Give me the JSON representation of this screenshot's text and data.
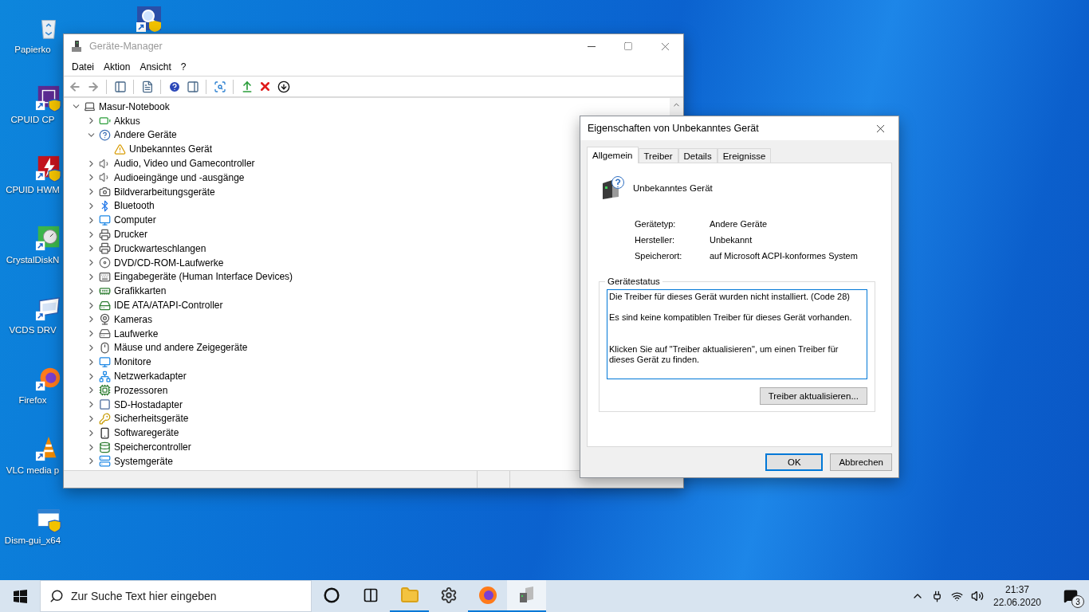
{
  "desktop_icons": [
    {
      "label": "Papierko"
    },
    {
      "label": "CPUID CP"
    },
    {
      "label": "CPUID HWM"
    },
    {
      "label": "CrystalDiskN"
    },
    {
      "label": "VCDS DRV"
    },
    {
      "label": "Firefox"
    },
    {
      "label": "VLC media p"
    },
    {
      "label": "Dism-gui_x64"
    }
  ],
  "device_manager": {
    "title": "Geräte-Manager",
    "menu": [
      "Datei",
      "Aktion",
      "Ansicht",
      "?"
    ],
    "tree": {
      "label": "Masur-Notebook",
      "expanded": true,
      "children": [
        {
          "label": "Akkus",
          "expanded": false
        },
        {
          "label": "Andere Geräte",
          "expanded": true,
          "children": [
            {
              "label": "Unbekanntes Gerät"
            }
          ]
        },
        {
          "label": "Audio, Video und Gamecontroller",
          "expanded": false
        },
        {
          "label": "Audioeingänge und -ausgänge",
          "expanded": false
        },
        {
          "label": "Bildverarbeitungsgeräte",
          "expanded": false
        },
        {
          "label": "Bluetooth",
          "expanded": false
        },
        {
          "label": "Computer",
          "expanded": false
        },
        {
          "label": "Drucker",
          "expanded": false
        },
        {
          "label": "Druckwarteschlangen",
          "expanded": false
        },
        {
          "label": "DVD/CD-ROM-Laufwerke",
          "expanded": false
        },
        {
          "label": "Eingabegeräte (Human Interface Devices)",
          "expanded": false
        },
        {
          "label": "Grafikkarten",
          "expanded": false
        },
        {
          "label": "IDE ATA/ATAPI-Controller",
          "expanded": false
        },
        {
          "label": "Kameras",
          "expanded": false
        },
        {
          "label": "Laufwerke",
          "expanded": false
        },
        {
          "label": "Mäuse und andere Zeigegeräte",
          "expanded": false
        },
        {
          "label": "Monitore",
          "expanded": false
        },
        {
          "label": "Netzwerkadapter",
          "expanded": false
        },
        {
          "label": "Prozessoren",
          "expanded": false
        },
        {
          "label": "SD-Hostadapter",
          "expanded": false
        },
        {
          "label": "Sicherheitsgeräte",
          "expanded": false
        },
        {
          "label": "Softwaregeräte",
          "expanded": false
        },
        {
          "label": "Speichercontroller",
          "expanded": false
        },
        {
          "label": "Systemgeräte",
          "expanded": false
        }
      ]
    }
  },
  "properties_dialog": {
    "title": "Eigenschaften von Unbekanntes Gerät",
    "tabs": [
      {
        "label": "Allgemein",
        "selected": true
      },
      {
        "label": "Treiber",
        "selected": false
      },
      {
        "label": "Details",
        "selected": false
      },
      {
        "label": "Ereignisse",
        "selected": false
      }
    ],
    "device_name": "Unbekanntes Gerät",
    "fields": [
      {
        "label": "Gerätetyp:",
        "value": "Andere Geräte"
      },
      {
        "label": "Hersteller:",
        "value": "Unbekannt"
      },
      {
        "label": "Speicherort:",
        "value": "auf Microsoft ACPI-konformes System"
      }
    ],
    "status_group": {
      "legend": "Gerätestatus",
      "text": "Die Treiber für dieses Gerät wurden nicht installiert. (Code 28)\n\nEs sind keine kompatiblen Treiber für dieses Gerät vorhanden.\n\n\nKlicken Sie auf \"Treiber aktualisieren\", um einen Treiber für dieses Gerät zu finden.",
      "button": "Treiber aktualisieren..."
    },
    "buttons": [
      {
        "label": "OK",
        "default": true
      },
      {
        "label": "Abbrechen",
        "default": false
      }
    ]
  },
  "taskbar": {
    "search": {
      "placeholder": "Zur Suche Text hier eingeben"
    },
    "apps": [
      {
        "kind": "cortana",
        "running": false,
        "selected": false
      },
      {
        "kind": "taskview",
        "running": false,
        "selected": false
      },
      {
        "kind": "explorer",
        "running": true,
        "selected": false
      },
      {
        "kind": "settings",
        "running": false,
        "selected": false
      },
      {
        "kind": "firefox",
        "running": true,
        "selected": false
      },
      {
        "kind": "devmgr",
        "running": true,
        "selected": true
      }
    ],
    "clock": {
      "time": "21:37",
      "date": "22.06.2020"
    },
    "notifications": "3"
  }
}
